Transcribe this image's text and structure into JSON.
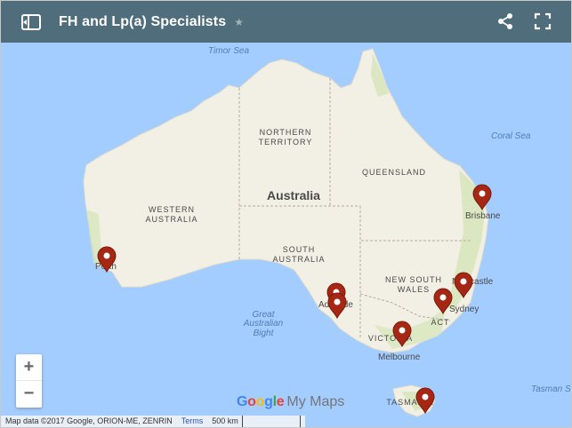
{
  "header": {
    "title": "FH and Lp(a) Specialists",
    "star": "★"
  },
  "map": {
    "country_label": "Australia",
    "regions": {
      "nt_line1": "NORTHERN",
      "nt_line2": "TERRITORY",
      "qld": "QUEENSLAND",
      "wa_line1": "WESTERN",
      "wa_line2": "AUSTRALIA",
      "sa_line1": "SOUTH",
      "sa_line2": "AUSTRALIA",
      "nsw_line1": "NEW SOUTH",
      "nsw_line2": "WALES",
      "act": "ACT",
      "vic": "VICTORIA",
      "tas": "TASMANIA"
    },
    "seas": {
      "timor": "Timor Sea",
      "coral": "Coral Sea",
      "bight_line1": "Great",
      "bight_line2": "Australian",
      "bight_line3": "Bight",
      "tasman": "Tasman S"
    },
    "cities": {
      "brisbane": "Brisbane",
      "perth": "Perth",
      "adelaide": "Adelaide",
      "newcastle": "Newcastle",
      "sydney": "Sydney",
      "melbourne": "Melbourne"
    },
    "marker_color": "#a52714"
  },
  "controls": {
    "zoom_in": "+",
    "zoom_out": "−"
  },
  "branding": {
    "google": "Google",
    "my_maps": "My Maps"
  },
  "footer": {
    "attribution": "Map data ©2017 Google, ORION-ME, ZENRIN",
    "terms": "Terms",
    "scale": "500 km"
  }
}
